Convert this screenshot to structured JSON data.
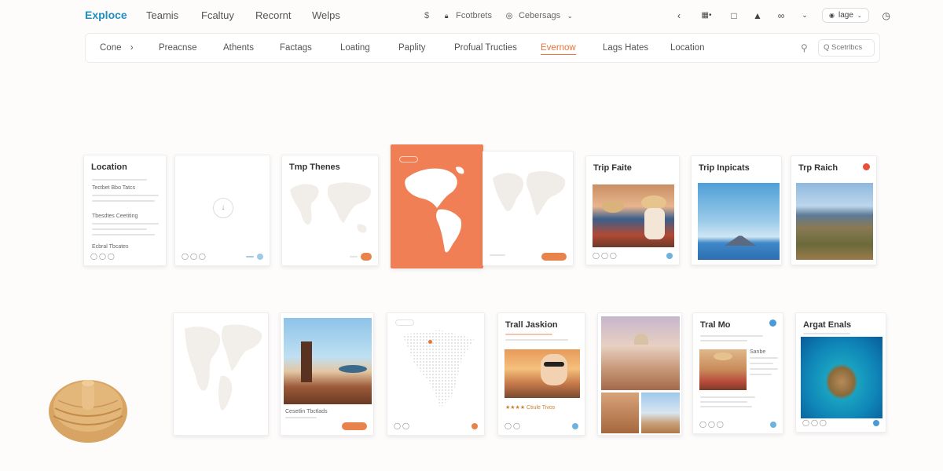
{
  "nav": {
    "brand": "Exploce",
    "links": [
      "Teamis",
      "Fcaltuy",
      "Recornt",
      "Welps"
    ],
    "center_tools": {
      "dollar": "$",
      "item1": "Fcotbrets",
      "item2": "Cebersags"
    },
    "signin": "lage"
  },
  "categories": {
    "items": [
      "Cone",
      "Preacnse",
      "Athents",
      "Factags",
      "Loating",
      "Paplity",
      "Profual Tructies",
      "Evernow",
      "Lags Hates",
      "Location"
    ],
    "active": "Evernow",
    "search_placeholder": "Q Scetrlbcs"
  },
  "cards_row1": [
    {
      "title": "Location",
      "sub1": "Tectbet Bbo Tatcs",
      "sub2": "Tbesdtes Ceetiting",
      "foot": "Ecbral Tbcates"
    },
    {
      "title": ""
    },
    {
      "title": "Tmp Thenes"
    },
    {
      "title": ""
    },
    {
      "title": ""
    },
    {
      "title": "Trip Faite"
    },
    {
      "title": "Trip Inpicats"
    },
    {
      "title": "Trp Raich"
    }
  ],
  "cards_row2": [
    {
      "title": ""
    },
    {
      "title": "",
      "caption": "Cesetlin Tbctlads"
    },
    {
      "title": ""
    },
    {
      "title": "Trall Jaskion",
      "rating": "★★★★ Ctiule Tivos"
    },
    {
      "title": ""
    },
    {
      "title": "Tral Mo",
      "side": "Sanbe"
    },
    {
      "title": "Argat Enals"
    }
  ],
  "colors": {
    "accent": "#e8743c",
    "brand": "#1f8fc0",
    "map_orange": "#f07f56"
  }
}
